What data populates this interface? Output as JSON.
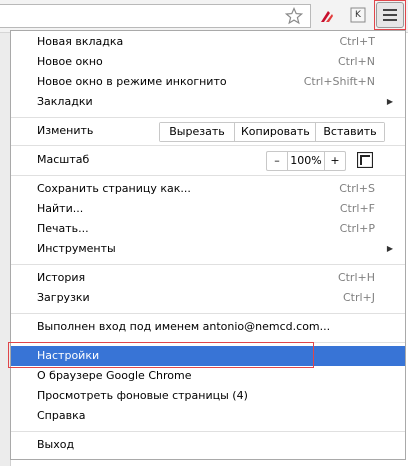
{
  "menu": {
    "new_tab": {
      "label": "Новая вкладка",
      "shortcut": "Ctrl+T"
    },
    "new_window": {
      "label": "Новое окно",
      "shortcut": "Ctrl+N"
    },
    "incognito": {
      "label": "Новое окно в режиме инкогнито",
      "shortcut": "Ctrl+Shift+N"
    },
    "bookmarks": {
      "label": "Закладки"
    },
    "edit": {
      "label": "Изменить",
      "cut": "Вырезать",
      "copy": "Копировать",
      "paste": "Вставить"
    },
    "zoom": {
      "label": "Масштаб",
      "minus": "–",
      "value": "100%",
      "plus": "+"
    },
    "save_page": {
      "label": "Сохранить страницу как...",
      "shortcut": "Ctrl+S"
    },
    "find": {
      "label": "Найти...",
      "shortcut": "Ctrl+F"
    },
    "print": {
      "label": "Печать...",
      "shortcut": "Ctrl+P"
    },
    "tools": {
      "label": "Инструменты"
    },
    "history": {
      "label": "История",
      "shortcut": "Ctrl+H"
    },
    "downloads": {
      "label": "Загрузки",
      "shortcut": "Ctrl+J"
    },
    "signed_in": {
      "label": "Выполнен вход под именем antonio@nemcd.com..."
    },
    "settings": {
      "label": "Настройки"
    },
    "about": {
      "label": "О браузере Google Chrome"
    },
    "background_pages": {
      "label": "Просмотреть фоновые страницы (4)"
    },
    "help": {
      "label": "Справка"
    },
    "exit": {
      "label": "Выход"
    }
  },
  "toolbar": {
    "ext2_letter": "K"
  },
  "colors": {
    "selected": "#3874d6",
    "highlight": "#e0464a"
  }
}
